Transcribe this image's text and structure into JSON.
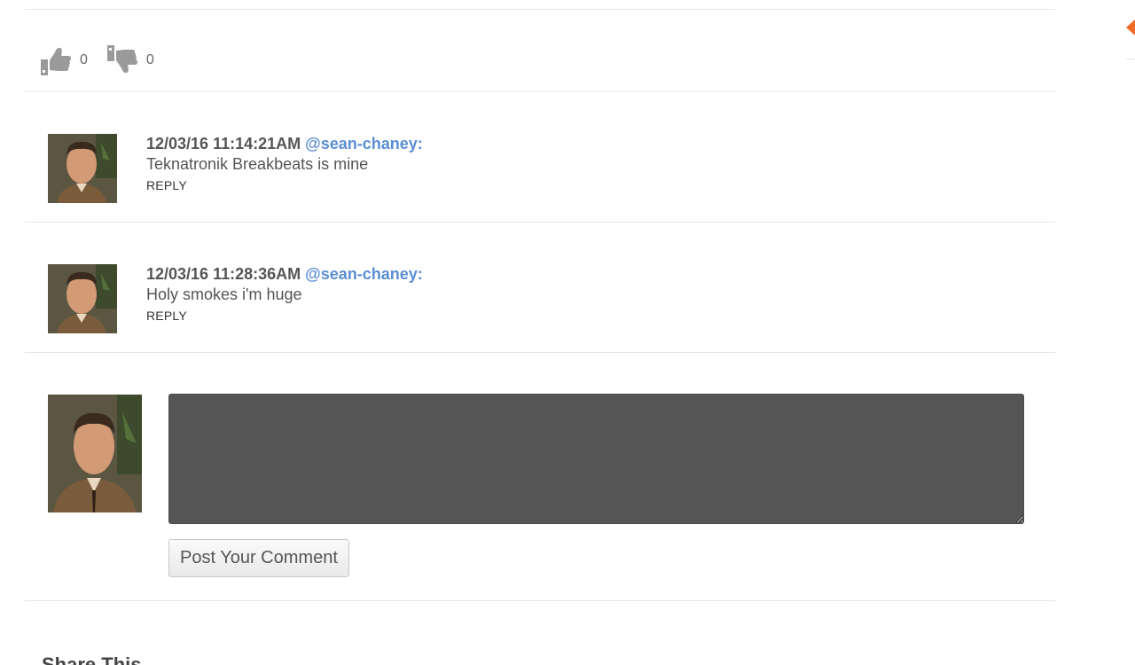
{
  "votes": {
    "likes": "0",
    "dislikes": "0"
  },
  "comments": [
    {
      "timestamp": "12/03/16 11:14:21AM",
      "username": "@sean-chaney",
      "text": "Teknatronik Breakbeats is mine",
      "reply_label": "REPLY"
    },
    {
      "timestamp": "12/03/16 11:28:36AM",
      "username": "@sean-chaney",
      "text": "Holy smokes i'm huge",
      "reply_label": "REPLY"
    }
  ],
  "comment_form": {
    "textarea_value": "",
    "post_label": "Post Your Comment"
  },
  "share": {
    "heading": "Share This"
  },
  "icons": {
    "like": "thumbs-up-icon",
    "dislike": "thumbs-down-icon",
    "side": "orange-arrow-icon"
  },
  "colors": {
    "username": "#5b8ed3",
    "accent": "#f06a25",
    "textarea_bg": "#555555"
  }
}
